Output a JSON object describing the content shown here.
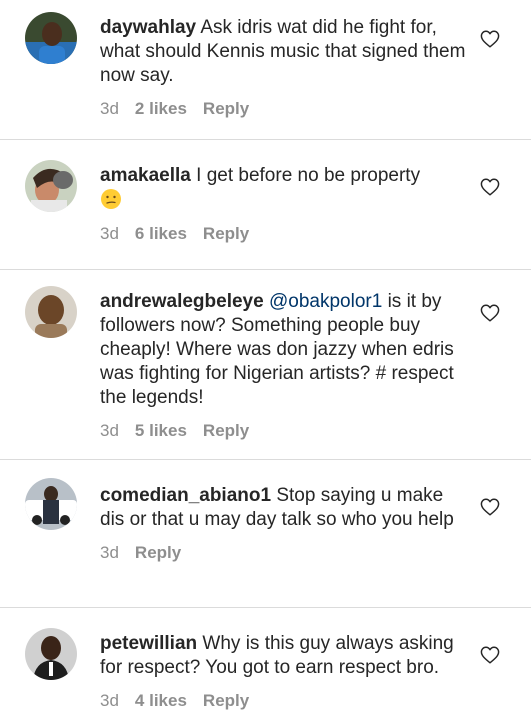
{
  "comments": [
    {
      "username": "daywahlay",
      "text": "Ask idris wat did he fight for, what should Kennis music that signed them now say.",
      "time": "3d",
      "likes": "2 likes",
      "reply": "Reply",
      "avatar_color": "#2a6fb3"
    },
    {
      "username": "amakaella",
      "text": "I get before no be property",
      "emoji": "smirking-face",
      "time": "3d",
      "likes": "6 likes",
      "reply": "Reply",
      "avatar_color": "#b9c4b0"
    },
    {
      "username": "andrewalegbeleye",
      "mention": "@obakpolor1",
      "text": "is it by followers now? Something people buy cheaply! Where was don jazzy when edris was fighting for Nigerian artists? # respect the legends!",
      "time": "3d",
      "likes": "5 likes",
      "reply": "Reply",
      "avatar_color": "#8a6a4a"
    },
    {
      "username": "comedian_abiano1",
      "text": "Stop saying u make dis  or that u may day talk so who you help",
      "time": "3d",
      "likes": "",
      "reply": "Reply",
      "avatar_color": "#7a8a9a"
    },
    {
      "username": "petewillian",
      "text": "Why is this guy always asking for respect? You got to earn respect bro.",
      "time": "3d",
      "likes": "4 likes",
      "reply": "Reply",
      "avatar_color": "#c8c8c8"
    }
  ],
  "icons": {
    "like": "heart-outline-icon"
  },
  "colors": {
    "username": "#262626",
    "meta": "#8e8e8e",
    "mention": "#003569",
    "divider": "#dbdbdb"
  }
}
